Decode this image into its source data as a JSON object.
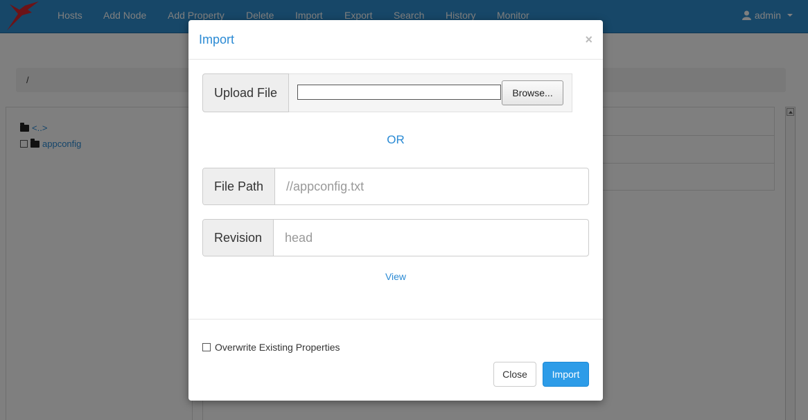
{
  "navbar": {
    "items": [
      "Hosts",
      "Add Node",
      "Add Property",
      "Delete",
      "Import",
      "Export",
      "Search",
      "History",
      "Monitor"
    ],
    "user": "admin"
  },
  "breadcrumb": {
    "path": "/"
  },
  "tree": {
    "parent": "<..>",
    "folder": "appconfig"
  },
  "modal": {
    "title": "Import",
    "close_symbol": "×",
    "upload_label": "Upload File",
    "browse_label": "Browse...",
    "or_label": "OR",
    "file_path_label": "File Path",
    "file_path_placeholder": "//appconfig.txt",
    "revision_label": "Revision",
    "revision_placeholder": "head",
    "view_link": "View",
    "overwrite_label": "Overwrite Existing Properties",
    "overwrite_checked": false,
    "close_button": "Close",
    "import_button": "Import"
  },
  "colors": {
    "navbar": "#2f8fd0",
    "accent": "#2a8ad4",
    "primary_button": "#2d9ce8",
    "logo": "#d9262e"
  },
  "icons": {
    "logo": "hummingbird-logo-icon",
    "user": "user-icon",
    "folder": "folder-icon"
  }
}
